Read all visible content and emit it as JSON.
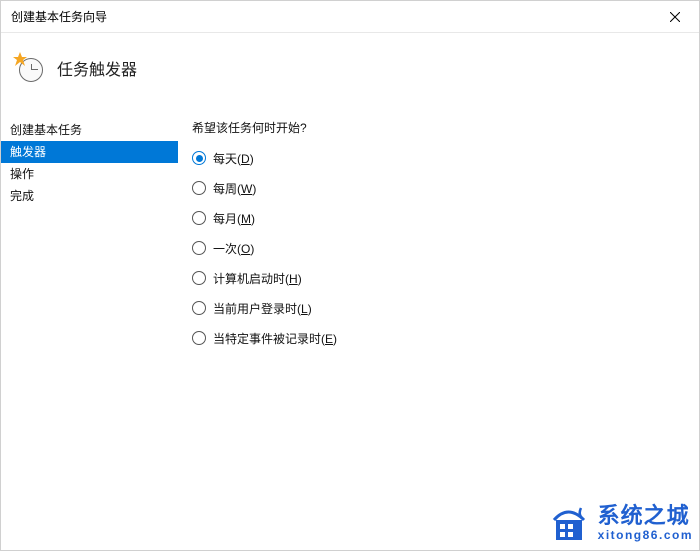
{
  "window": {
    "title": "创建基本任务向导"
  },
  "header": {
    "title": "任务触发器"
  },
  "sidebar": {
    "items": [
      {
        "label": "创建基本任务",
        "active": false
      },
      {
        "label": "触发器",
        "active": true
      },
      {
        "label": "操作",
        "active": false
      },
      {
        "label": "完成",
        "active": false
      }
    ]
  },
  "main": {
    "question": "希望该任务何时开始?",
    "options": [
      {
        "text": "每天",
        "accel": "D",
        "selected": true
      },
      {
        "text": "每周",
        "accel": "W",
        "selected": false
      },
      {
        "text": "每月",
        "accel": "M",
        "selected": false
      },
      {
        "text": "一次",
        "accel": "O",
        "selected": false
      },
      {
        "text": "计算机启动时",
        "accel": "H",
        "selected": false
      },
      {
        "text": "当前用户登录时",
        "accel": "L",
        "selected": false
      },
      {
        "text": "当特定事件被记录时",
        "accel": "E",
        "selected": false
      }
    ]
  },
  "watermark": {
    "text_cn": "系统之城",
    "url": "xitong86.com"
  }
}
